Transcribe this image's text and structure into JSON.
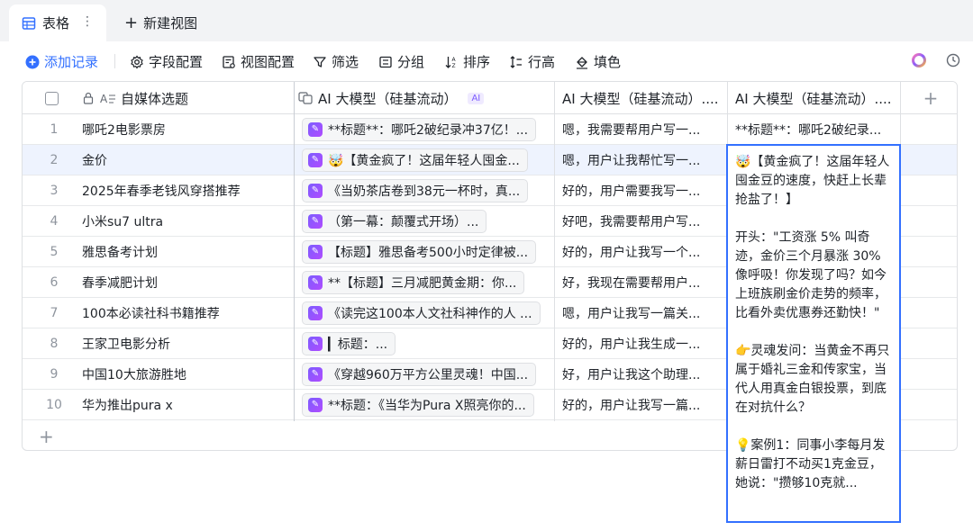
{
  "tabs": {
    "active_label": "表格",
    "new_view_label": "新建视图"
  },
  "toolbar": {
    "add_record": "添加记录",
    "field_config": "字段配置",
    "view_config": "视图配置",
    "filter": "筛选",
    "group": "分组",
    "sort": "排序",
    "row_height": "行高",
    "fill": "填色"
  },
  "columns": {
    "primary": "自媒体选题",
    "ai1": "AI 大模型（硅基流动）",
    "ai1_badge": "AI",
    "ai2": "AI 大模型（硅基流动）....",
    "ai3": "AI 大模型（硅基流动）...."
  },
  "rows": [
    {
      "num": "1",
      "title": "哪吒2电影票房",
      "ai1": "**标题**：哪吒2破纪录冲37亿！...",
      "ai2": "嗯，我需要帮用户写一...",
      "ai3": "**标题**：哪吒2破纪录..."
    },
    {
      "num": "2",
      "title": "金价",
      "ai1": "🤯【黄金疯了！这届年轻人囤金...",
      "ai2": "嗯，用户让我帮忙写一...",
      "ai3": ""
    },
    {
      "num": "3",
      "title": "2025年春季老钱风穿搭推荐",
      "ai1": "《当奶茶店卷到38元一杯时，真...",
      "ai2": "好的，用户需要我写一...",
      "ai3": ""
    },
    {
      "num": "4",
      "title": "小米su7 ultra",
      "ai1": "（第一幕：颠覆式开场）...",
      "ai2": "好吧，我需要帮用户写...",
      "ai3": ""
    },
    {
      "num": "5",
      "title": "雅思备考计划",
      "ai1": "【标题】雅思备考500小时定律被...",
      "ai2": "好的，用户让我写一个...",
      "ai3": ""
    },
    {
      "num": "6",
      "title": "春季减肥计划",
      "ai1": "**【标题】三月减肥黄金期：你...",
      "ai2": "好，我现在需要帮用户...",
      "ai3": ""
    },
    {
      "num": "7",
      "title": "100本必读社科书籍推荐",
      "ai1": "《读完这100本人文社科神作的人 ...",
      "ai2": "嗯，用户让我写一篇关...",
      "ai3": ""
    },
    {
      "num": "8",
      "title": "王家卫电影分析",
      "ai1": "▎标题：...",
      "ai2": "好的，用户让我生成一...",
      "ai3": ""
    },
    {
      "num": "9",
      "title": "中国10大旅游胜地",
      "ai1": "《穿越960万平方公里灵魂！中国...",
      "ai2": "好，用户让我这个助理...",
      "ai3": ""
    },
    {
      "num": "10",
      "title": "华为推出pura x",
      "ai1": "**标题：《当华为Pura X照亮你的...",
      "ai2": "好的，用户让我写一篇...",
      "ai3": ""
    }
  ],
  "expanded_cell": {
    "p1": "🤯【黄金疯了！这届年轻人囤金豆的速度，快赶上长辈抢盐了！】",
    "p2": "开头：\"工资涨 5% 叫奇迹，金价三个月暴涨 30% 像呼吸！你发现了吗？如今上班族刷金价走势的频率，比看外卖优惠券还勤快！\"",
    "p3": "👉灵魂发问：当黄金不再只属于婚礼三金和传家宝，当代人用真金白银投票，到底在对抗什么？",
    "p4": "💡案例1：同事小李每月发薪日雷打不动买1克金豆，她说：\"攒够10克就..."
  },
  "colors": {
    "accent": "#3370ff",
    "selected_row": "#eef3fe",
    "ai_badge": "#7c5cff"
  }
}
